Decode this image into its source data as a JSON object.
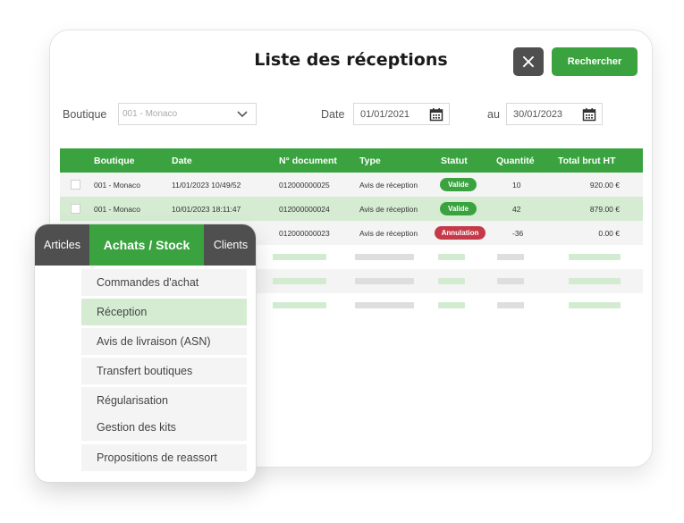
{
  "header": {
    "title": "Liste des réceptions",
    "close_icon": "×",
    "search_label": "Rechercher"
  },
  "filters": {
    "boutique_label": "Boutique",
    "boutique_value": "001 - Monaco",
    "date_label": "Date",
    "date_from": "01/01/2021",
    "au_label": "au",
    "date_to": "30/01/2023"
  },
  "table": {
    "columns": [
      "Boutique",
      "Date",
      "N° document",
      "Type",
      "Statut",
      "Quantité",
      "Total brut HT"
    ],
    "rows": [
      {
        "boutique": "001 - Monaco",
        "date": "11/01/2023 10/49/52",
        "document": "012000000025",
        "type": "Avis de réception",
        "statut": "Valide",
        "quantite": "10",
        "total": "920.00 €"
      },
      {
        "boutique": "001 - Monaco",
        "date": "10/01/2023 18:11:47",
        "document": "012000000024",
        "type": "Avis de réception",
        "statut": "Valide",
        "quantite": "42",
        "total": "879.00 €"
      },
      {
        "boutique": "",
        "date": "",
        "document": "012000000023",
        "type": "Avis de réception",
        "statut": "Annulation",
        "quantite": "-36",
        "total": "0.00 €"
      }
    ]
  },
  "menu_panel": {
    "tabs": [
      "Articles",
      "Achats / Stock",
      "Clients"
    ],
    "items": [
      "Commandes d'achat",
      "Réception",
      "Avis de livraison (ASN)",
      "Transfert boutiques",
      "Régularisation",
      "Gestion des kits",
      "Propositions de reassort"
    ]
  },
  "colors": {
    "accent": "#3aa33f",
    "dark": "#4f4f4f",
    "danger": "#c53a48",
    "highlight": "#d5ecd2"
  }
}
